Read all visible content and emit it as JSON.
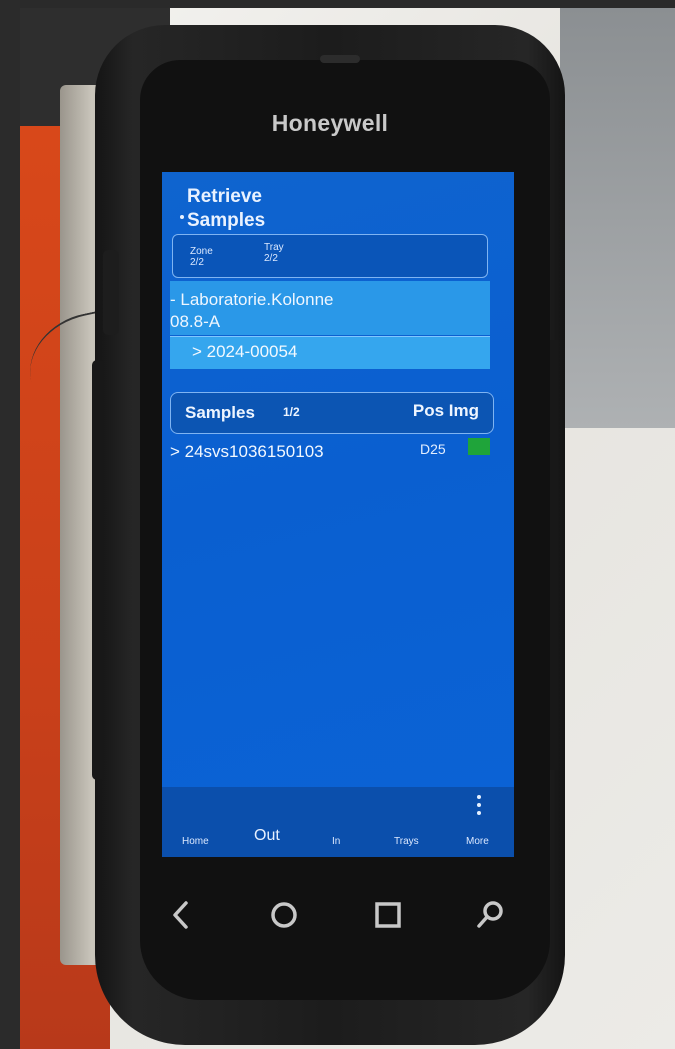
{
  "device": {
    "brand": "Honeywell"
  },
  "screen": {
    "title_line1": "Retrieve",
    "title_line2": "Samples",
    "zone_label": "Zone",
    "zone_value": "2/2",
    "tray_label": "Tray",
    "tray_value": "2/2",
    "location_line1": "- Laboratorie.Kolonne",
    "location_line2": "08.8-A",
    "order": "> 2024-00054",
    "samples_header": {
      "label": "Samples",
      "count": "1/2",
      "pos_img_label": "Pos Img"
    },
    "rows": [
      {
        "sample_id": "> 24svs1036150103",
        "pos": "D25",
        "img_color": "#1fa43a"
      }
    ],
    "nav": {
      "home": "Home",
      "out": "Out",
      "in": "In",
      "trays": "Trays",
      "more": "More"
    }
  },
  "softkeys": [
    "back-icon",
    "home-circle-icon",
    "recents-square-icon",
    "search-icon"
  ],
  "colors": {
    "screen_blue": "#0a5fd0",
    "highlight_blue": "#2a98e8",
    "status_green": "#1fa43a"
  }
}
